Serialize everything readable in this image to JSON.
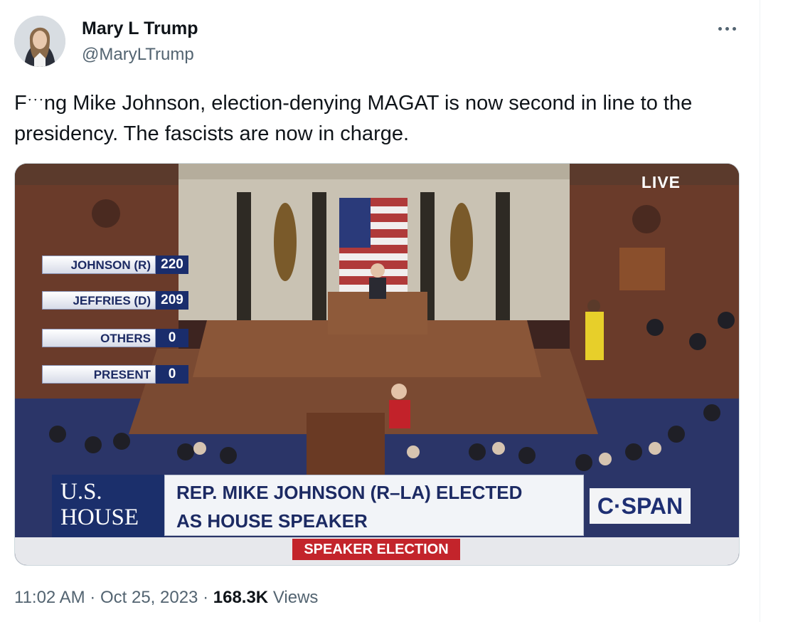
{
  "author": {
    "name": "Mary L Trump",
    "handle": "@MaryLTrump"
  },
  "tweet": {
    "text": "Fˑˑˑng Mike Johnson, election-denying MAGAT is now second in line to the presidency. The fascists are now in charge."
  },
  "media": {
    "live_label": "LIVE",
    "tally": [
      {
        "label": "JOHNSON (R)",
        "value": "220"
      },
      {
        "label": "JEFFRIES (D)",
        "value": "209"
      },
      {
        "label": "OTHERS",
        "value": "0"
      },
      {
        "label": "PRESENT",
        "value": "0"
      }
    ],
    "house_logo_line1": "U.S.",
    "house_logo_line2": "HOUSE",
    "headline_line1": "REP. MIKE JOHNSON (R–LA) ELECTED",
    "headline_line2": "AS HOUSE SPEAKER",
    "network": "C·SPAN",
    "segment": "SPEAKER ELECTION"
  },
  "meta": {
    "time": "11:02 AM",
    "separator": "·",
    "date": "Oct 25, 2023",
    "views_count": "168.3K",
    "views_label": "Views"
  },
  "icons": {
    "more": "more-horizontal-icon"
  }
}
